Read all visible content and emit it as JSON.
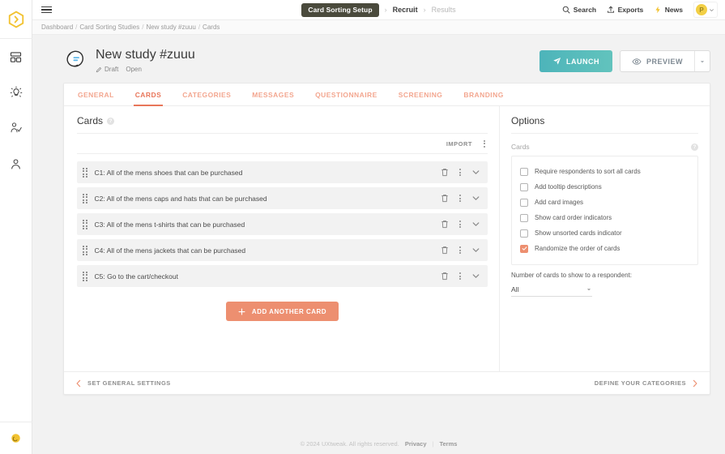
{
  "rail": {
    "logo_icon": "hexagon-chevron-logo",
    "items": [
      {
        "icon": "dashboard-grid-icon",
        "name": "dashboard"
      },
      {
        "icon": "lightbulb-idea-icon",
        "name": "insights"
      },
      {
        "icon": "user-research-icon",
        "name": "research"
      },
      {
        "icon": "person-icon",
        "name": "account"
      }
    ],
    "bottom_icon": "moon-theme-icon"
  },
  "topbar": {
    "menu_icon": "hamburger-menu-icon",
    "nav": {
      "active_pill": "Card Sorting Setup",
      "items": [
        {
          "label": "Recruit",
          "muted": false
        },
        {
          "label": "Results",
          "muted": true
        }
      ],
      "separator": "›"
    },
    "actions": [
      {
        "label": "Search",
        "icon": "search-icon"
      },
      {
        "label": "Exports",
        "icon": "export-upload-icon"
      },
      {
        "label": "News",
        "icon": "lightning-bolt-icon"
      }
    ],
    "avatar": {
      "initial": "P",
      "caret": "∨"
    }
  },
  "breadcrumb": {
    "separator": "/",
    "items": [
      "Dashboard",
      "Card Sorting Studies",
      "New study #zuuu",
      "Cards"
    ]
  },
  "study": {
    "icon": "card-sorting-study-icon",
    "title": "New study #zuuu",
    "status_edit": "Draft",
    "status_state": "Open",
    "edit_icon": "pencil-icon",
    "launch_label": "LAUNCH",
    "launch_icon": "paper-plane-icon",
    "preview_label": "PREVIEW",
    "preview_icon": "eye-icon",
    "preview_caret_icon": "caret-down-icon"
  },
  "tabs": [
    {
      "label": "GENERAL",
      "active": false
    },
    {
      "label": "CARDS",
      "active": true
    },
    {
      "label": "CATEGORIES",
      "active": false
    },
    {
      "label": "MESSAGES",
      "active": false
    },
    {
      "label": "QUESTIONNAIRE",
      "active": false
    },
    {
      "label": "SCREENING",
      "active": false
    },
    {
      "label": "BRANDING",
      "active": false
    }
  ],
  "cards_section": {
    "title": "Cards",
    "help_glyph": "?",
    "import_label": "IMPORT",
    "more_icon": "kebab-menu-icon",
    "rows": [
      {
        "text": "C1: All of the mens shoes that can be purchased"
      },
      {
        "text": "C2: All of the mens caps and hats that can be purchased"
      },
      {
        "text": "C3: All of the mens t-shirts that can be purchased"
      },
      {
        "text": "C4: All of the mens jackets that can be purchased"
      },
      {
        "text": "C5: Go to the cart/checkout"
      }
    ],
    "row_icons": {
      "drag": "drag-handle-icon",
      "delete": "trash-icon",
      "more": "kebab-menu-icon",
      "expand": "chevron-down-icon"
    },
    "add_card_label": "ADD ANOTHER CARD",
    "add_card_icon": "plus-icon"
  },
  "options_section": {
    "title": "Options",
    "subtitle": "Cards",
    "help_glyph": "?",
    "checkboxes": [
      {
        "label": "Require respondents to sort all cards",
        "checked": false
      },
      {
        "label": "Add tooltip descriptions",
        "checked": false
      },
      {
        "label": "Add card images",
        "checked": false
      },
      {
        "label": "Show card order indicators",
        "checked": false
      },
      {
        "label": "Show unsorted cards indicator",
        "checked": false
      },
      {
        "label": "Randomize the order of cards",
        "checked": true
      }
    ],
    "number_label": "Number of cards to show to a respondent:",
    "number_value": "All",
    "number_caret_icon": "caret-down-icon"
  },
  "card_footer": {
    "prev_label": "SET GENERAL SETTINGS",
    "prev_icon": "chevron-left-icon",
    "next_label": "DEFINE YOUR CATEGORIES",
    "next_icon": "chevron-right-icon"
  },
  "page_footer": {
    "copyright": "© 2024 UXtweak. All rights reserved.",
    "privacy": "Privacy",
    "divider": "|",
    "terms": "Terms"
  },
  "colors": {
    "accent_coral": "#e8765a",
    "accent_coral_light": "#ed8f70",
    "teal_start": "#4db4ba",
    "teal_end": "#62c3bd",
    "brand_yellow": "#f2cf45",
    "nav_pill_dark": "#4a4a3c"
  }
}
